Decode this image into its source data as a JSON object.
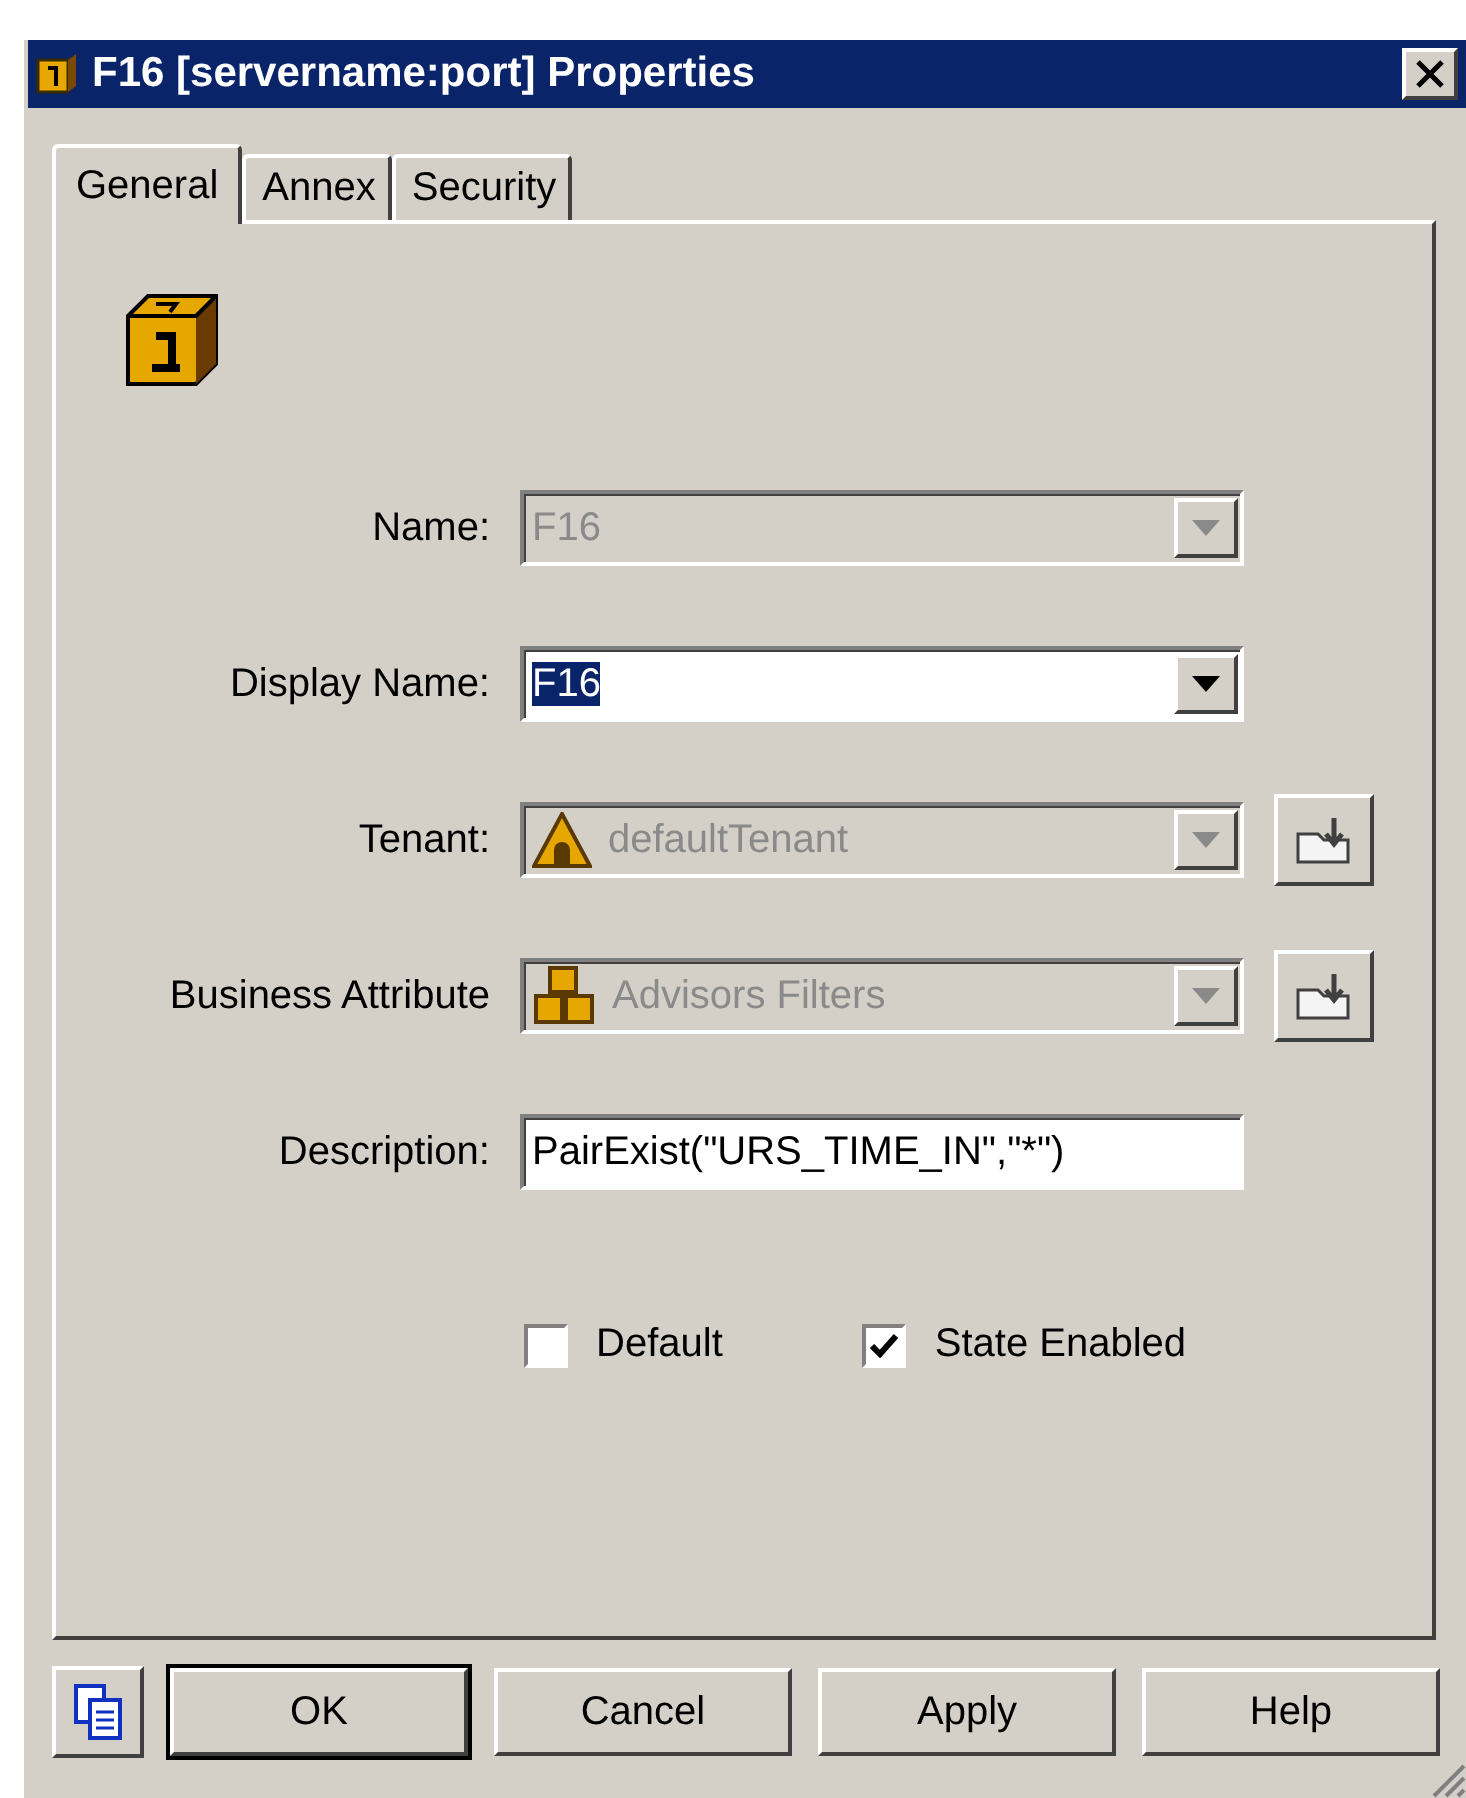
{
  "window": {
    "title": "F16 [servername:port] Properties"
  },
  "tabs": [
    {
      "label": "General",
      "selected": true
    },
    {
      "label": "Annex",
      "selected": false
    },
    {
      "label": "Security",
      "selected": false
    }
  ],
  "fields": [
    {
      "kind": "combo",
      "label": "Name:",
      "value": "F16",
      "disabled": true,
      "highlighted": false
    },
    {
      "kind": "combo",
      "label": "Display Name:",
      "value": "F16",
      "disabled": false,
      "highlighted": true
    },
    {
      "kind": "combo",
      "label": "Tenant:",
      "value": "defaultTenant",
      "disabled": true,
      "highlighted": false,
      "browse": true
    },
    {
      "kind": "combo",
      "label": "Business Attribute",
      "value": "Advisors Filters",
      "disabled": true,
      "highlighted": false,
      "browse": true
    },
    {
      "kind": "text",
      "label": "Description:",
      "value": "PairExist(\"URS_TIME_IN\",\"*\")",
      "disabled": false,
      "highlighted": false
    }
  ],
  "checkboxes": [
    {
      "label": "Default",
      "checked": false
    },
    {
      "label": "State Enabled",
      "checked": true
    }
  ],
  "buttons": [
    {
      "label": "OK",
      "default": true
    },
    {
      "label": "Cancel",
      "default": false
    },
    {
      "label": "Apply",
      "default": false
    },
    {
      "label": "Help",
      "default": false
    }
  ]
}
